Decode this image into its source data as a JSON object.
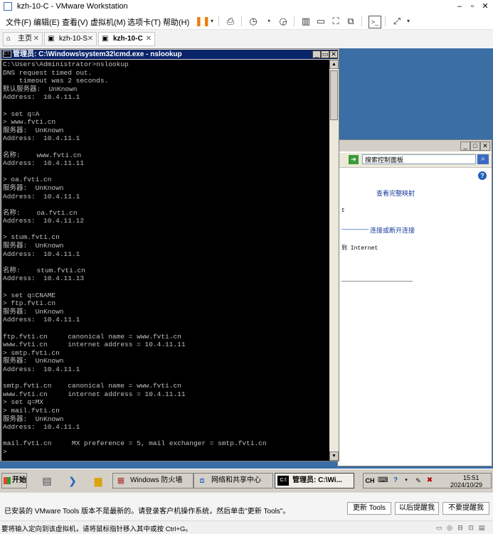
{
  "vmware": {
    "title": "kzh-10-C - VMware Workstation",
    "window_controls": {
      "minimize": "–",
      "maximize": "▫",
      "close": "✕"
    },
    "menu": [
      "文件(F)",
      "编辑(E)",
      "查看(V)",
      "虚拟机(M)",
      "选项卡(T)",
      "帮助(H)"
    ],
    "tabs": [
      {
        "label": "主页",
        "icon": "home-icon"
      },
      {
        "label": "kzh-10-S",
        "icon": "vm-icon"
      },
      {
        "label": "kzh-10-C",
        "icon": "vm-icon",
        "active": true
      }
    ]
  },
  "cmd": {
    "title": "管理员: C:\\Windows\\system32\\cmd.exe - nslookup",
    "icon_label": "C:\\",
    "output": "C:\\Users\\Administrator>nslookup\nDNS request timed out.\n    timeout was 2 seconds.\n默认服务器:  UnKnown\nAddress:  10.4.11.1\n\n> set q=A\n> www.fvti.cn\n服务器:  UnKnown\nAddress:  10.4.11.1\n\n名称:    www.fvti.cn\nAddress:  10.4.11.11\n\n> oa.fvti.cn\n服务器:  UnKnown\nAddress:  10.4.11.1\n\n名称:    oa.fvti.cn\nAddress:  10.4.11.12\n\n> stum.fvti.cn\n服务器:  UnKnown\nAddress:  10.4.11.1\n\n名称:    stum.fvti.cn\nAddress:  10.4.11.13\n\n> set q=CNAME\n> ftp.fvti.cn\n服务器:  UnKnown\nAddress:  10.4.11.1\n\nftp.fvti.cn     canonical name = www.fvti.cn\nwww.fvti.cn     internet address = 10.4.11.11\n> smtp.fvti.cn\n服务器:  UnKnown\nAddress:  10.4.11.1\n\nsmtp.fvti.cn    canonical name = www.fvti.cn\nwww.fvti.cn     internet address = 10.4.11.11\n> set q=MX\n> mail.fvti.cn\n服务器:  UnKnown\nAddress:  10.4.11.1\n\nmail.fvti.cn     MX preference = 5, mail exchanger = smtp.fvti.cn\n>"
  },
  "control_panel": {
    "search_placeholder": "搜索控制面板",
    "view_full_map": "查看完整映射",
    "connect_disconnect": "连接或断开连接",
    "text_t": "t",
    "text_internet": "到 Internet"
  },
  "taskbar": {
    "start": "开始",
    "tasks": [
      {
        "label": "Windows 防火墙",
        "icon": "firewall-icon"
      },
      {
        "label": "网络和共享中心",
        "icon": "network-icon"
      },
      {
        "label": "管理员: C:\\Wi...",
        "icon": "cmd-icon",
        "active": true
      }
    ],
    "tray": {
      "ime": "CH",
      "time": "15:51",
      "date": "2024/10/29"
    }
  },
  "notification": {
    "message": "已安装的 VMware Tools 版本不是最新的。请登录客户机操作系统，然后单击\"更新 Tools\"。",
    "buttons": [
      "更新 Tools",
      "以后提醒我",
      "不要提醒我"
    ]
  },
  "status": {
    "message": "要将输入定向到该虚拟机，请将鼠标指针移入其中或按 Ctrl+G。"
  }
}
